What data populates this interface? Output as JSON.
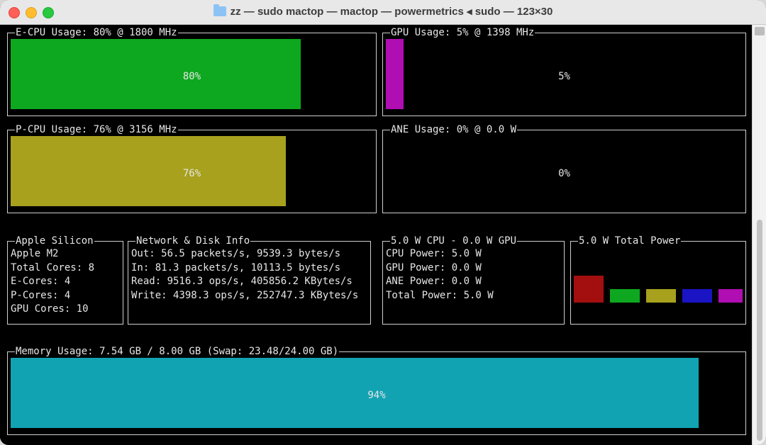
{
  "window": {
    "title": "zz — sudo mactop — mactop — powermetrics ◂ sudo — 123×30"
  },
  "ecpu": {
    "title": "E-CPU Usage: 80% @ 1800 MHz",
    "percent": 80,
    "label": "80%",
    "color": "#0da81f"
  },
  "gpu": {
    "title": "GPU Usage: 5% @ 1398 MHz",
    "percent": 5,
    "label": "5%",
    "color": "#b00db3"
  },
  "pcpu": {
    "title": "P-CPU Usage: 76% @ 3156 MHz",
    "percent": 76,
    "label": "76%",
    "color": "#a7a11d"
  },
  "ane": {
    "title": "ANE Usage: 0% @ 0.0 W",
    "percent": 0,
    "label": "0%",
    "color": "#0da81f"
  },
  "silicon": {
    "title": "Apple Silicon",
    "lines": [
      "Apple M2",
      "Total Cores: 8",
      "E-Cores: 4",
      "P-Cores: 4",
      "GPU Cores: 10"
    ]
  },
  "network": {
    "title": "Network & Disk Info",
    "lines": [
      "Out: 56.5 packets/s, 9539.3 bytes/s",
      "In: 81.3 packets/s, 10113.5 bytes/s",
      "Read: 9516.3 ops/s, 405856.2 KBytes/s",
      "Write: 4398.3 ops/s, 252747.3 KBytes/s"
    ]
  },
  "power": {
    "title": "5.0 W CPU - 0.0 W GPU",
    "lines": [
      "CPU Power: 5.0 W",
      "GPU Power: 0.0 W",
      "ANE Power: 0.0 W",
      "Total Power: 5.0 W"
    ]
  },
  "total_power": {
    "title": "5.0 W Total Power",
    "bars": [
      {
        "color": "#a30f0f",
        "level": 1.0
      },
      {
        "color": "#0da81f",
        "level": 0.5
      },
      {
        "color": "#a7a11d",
        "level": 0.5
      },
      {
        "color": "#1a14c4",
        "level": 0.5
      },
      {
        "color": "#b00db3",
        "level": 0.5
      }
    ]
  },
  "memory": {
    "title": "Memory Usage: 7.54 GB / 8.00 GB (Swap: 23.48/24.00 GB)",
    "percent": 94,
    "label": "94%",
    "color": "#12a3b3"
  }
}
